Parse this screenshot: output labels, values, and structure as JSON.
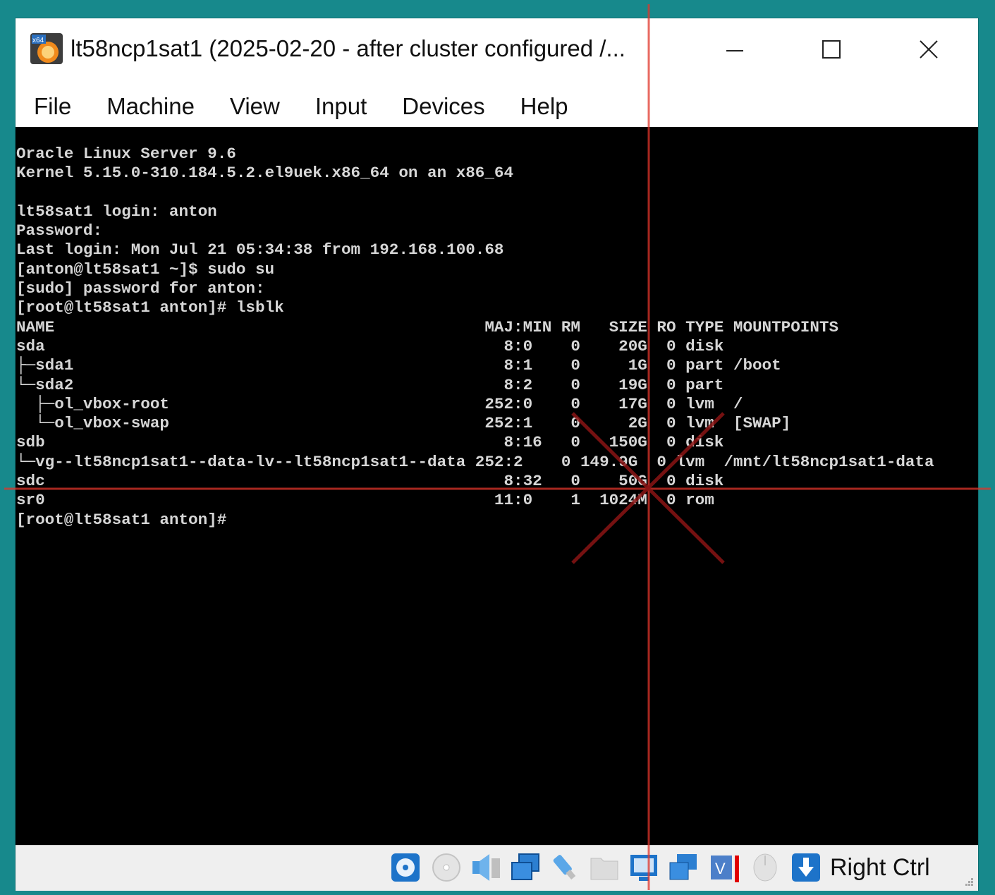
{
  "window": {
    "title": "lt58ncp1sat1 (2025-02-20 - after cluster configured /...",
    "controls": {
      "minimize": "minimize",
      "maximize": "maximize",
      "close": "close"
    }
  },
  "menu": [
    "File",
    "Machine",
    "View",
    "Input",
    "Devices",
    "Help"
  ],
  "console": {
    "lines": [
      "Oracle Linux Server 9.6",
      "Kernel 5.15.0-310.184.5.2.el9uek.x86_64 on an x86_64",
      "",
      "lt58sat1 login: anton",
      "Password:",
      "Last login: Mon Jul 21 05:34:38 from 192.168.100.68",
      "[anton@lt58sat1 ~]$ sudo su",
      "[sudo] password for anton:",
      "[root@lt58sat1 anton]# lsblk",
      "NAME                                             MAJ:MIN RM   SIZE RO TYPE MOUNTPOINTS",
      "sda                                                8:0    0    20G  0 disk",
      "├─sda1                                             8:1    0     1G  0 part /boot",
      "└─sda2                                             8:2    0    19G  0 part",
      "  ├─ol_vbox-root                                 252:0    0    17G  0 lvm  /",
      "  └─ol_vbox-swap                                 252:1    0     2G  0 lvm  [SWAP]",
      "sdb                                                8:16   0   150G  0 disk",
      "└─vg--lt58ncp1sat1--data-lv--lt58ncp1sat1--data 252:2    0 149.9G  0 lvm  /mnt/lt58ncp1sat1-data",
      "sdc                                                8:32   0    50G  0 disk",
      "sr0                                               11:0    1  1024M  0 rom",
      "[root@lt58sat1 anton]#"
    ]
  },
  "statusbar": {
    "icons": [
      "hard-disk-icon",
      "optical-drive-icon",
      "audio-icon",
      "network-icon",
      "usb-icon",
      "shared-folder-icon",
      "display-icon",
      "recording-icon",
      "vrde-icon",
      "mouse-integration-icon",
      "keyboard-capture-icon"
    ],
    "host_key": "Right Ctrl"
  },
  "colors": {
    "desktop": "#17898c",
    "console_bg": "#000000",
    "console_text": "#d6d6d6",
    "crosshair": "#e0352b",
    "crosshair_x": "#8a1414"
  }
}
